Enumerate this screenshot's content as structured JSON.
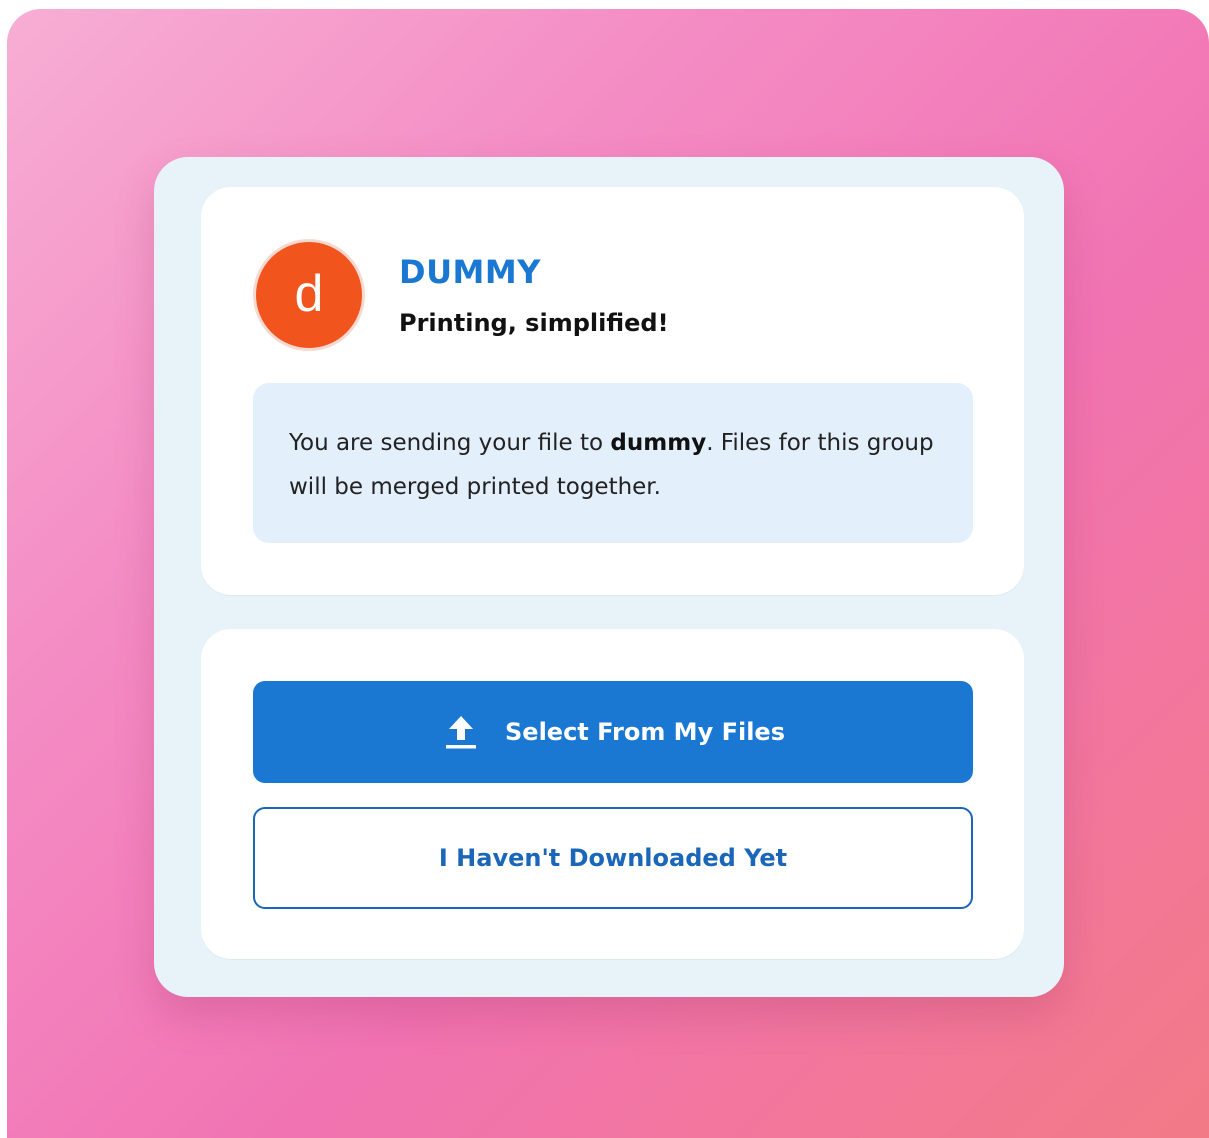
{
  "group": {
    "avatar_letter": "d",
    "name": "DUMMY",
    "tagline": "Printing, simplified!"
  },
  "info": {
    "prefix": "You are sending your file to ",
    "group_bold": "dummy",
    "suffix": ". Files for this group will be merged printed together."
  },
  "actions": {
    "select_label": "Select From My Files",
    "not_downloaded_label": "I Haven't Downloaded Yet"
  },
  "icons": {
    "upload": "upload-icon"
  },
  "colors": {
    "accent": "#1a78d3",
    "avatar": "#f2541e",
    "info_bg": "#e3effb"
  }
}
